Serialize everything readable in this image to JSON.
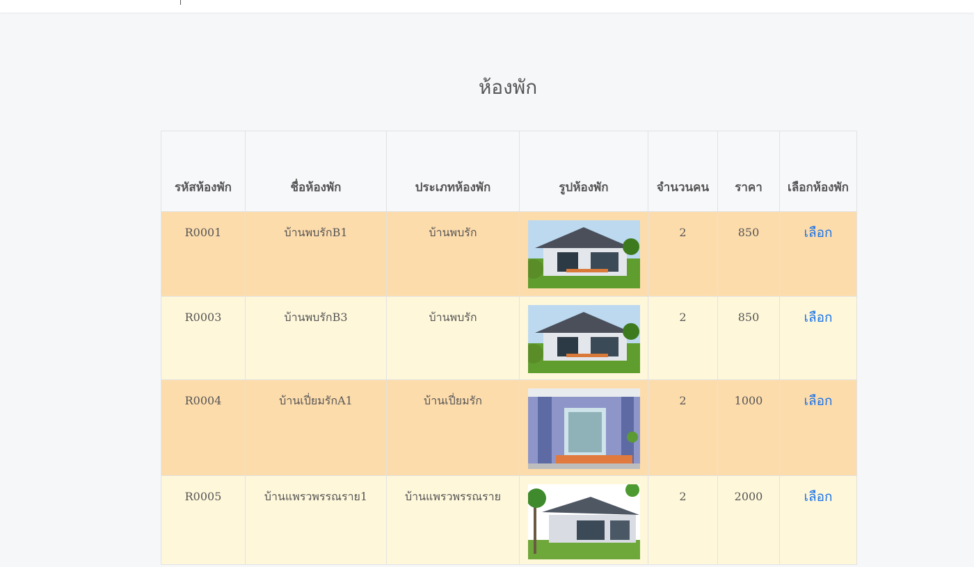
{
  "page": {
    "title": "ห้องพัก"
  },
  "table": {
    "headers": [
      "รหัสห้องพัก",
      "ชื่อห้องพัก",
      "ประเภทห้องพัก",
      "รูปห้องพัก",
      "จำนวนคน",
      "ราคา",
      "เลือกห้องพัก"
    ],
    "rows": [
      {
        "code": "R0001",
        "name": "บ้านพบรักB1",
        "type": "บ้านพบรัก",
        "image_icon": "house-photo-icon",
        "people": "2",
        "price": "850",
        "select_label": "เลือก"
      },
      {
        "code": "R0003",
        "name": "บ้านพบรักB3",
        "type": "บ้านพบรัก",
        "image_icon": "house-photo-icon",
        "people": "2",
        "price": "850",
        "select_label": "เลือก"
      },
      {
        "code": "R0004",
        "name": "บ้านเปี่ยมรักA1",
        "type": "บ้านเปี่ยมรัก",
        "image_icon": "porch-photo-icon",
        "people": "2",
        "price": "1000",
        "select_label": "เลือก"
      },
      {
        "code": "R0005",
        "name": "บ้านแพรวพรรณราย1",
        "type": "บ้านแพรวพรรณราย",
        "image_icon": "house-photo-icon",
        "people": "2",
        "price": "2000",
        "select_label": "เลือก"
      }
    ]
  },
  "colors": {
    "row_alt_a": "#fddcac",
    "row_alt_b": "#fef7da",
    "link": "#1a73e8"
  }
}
